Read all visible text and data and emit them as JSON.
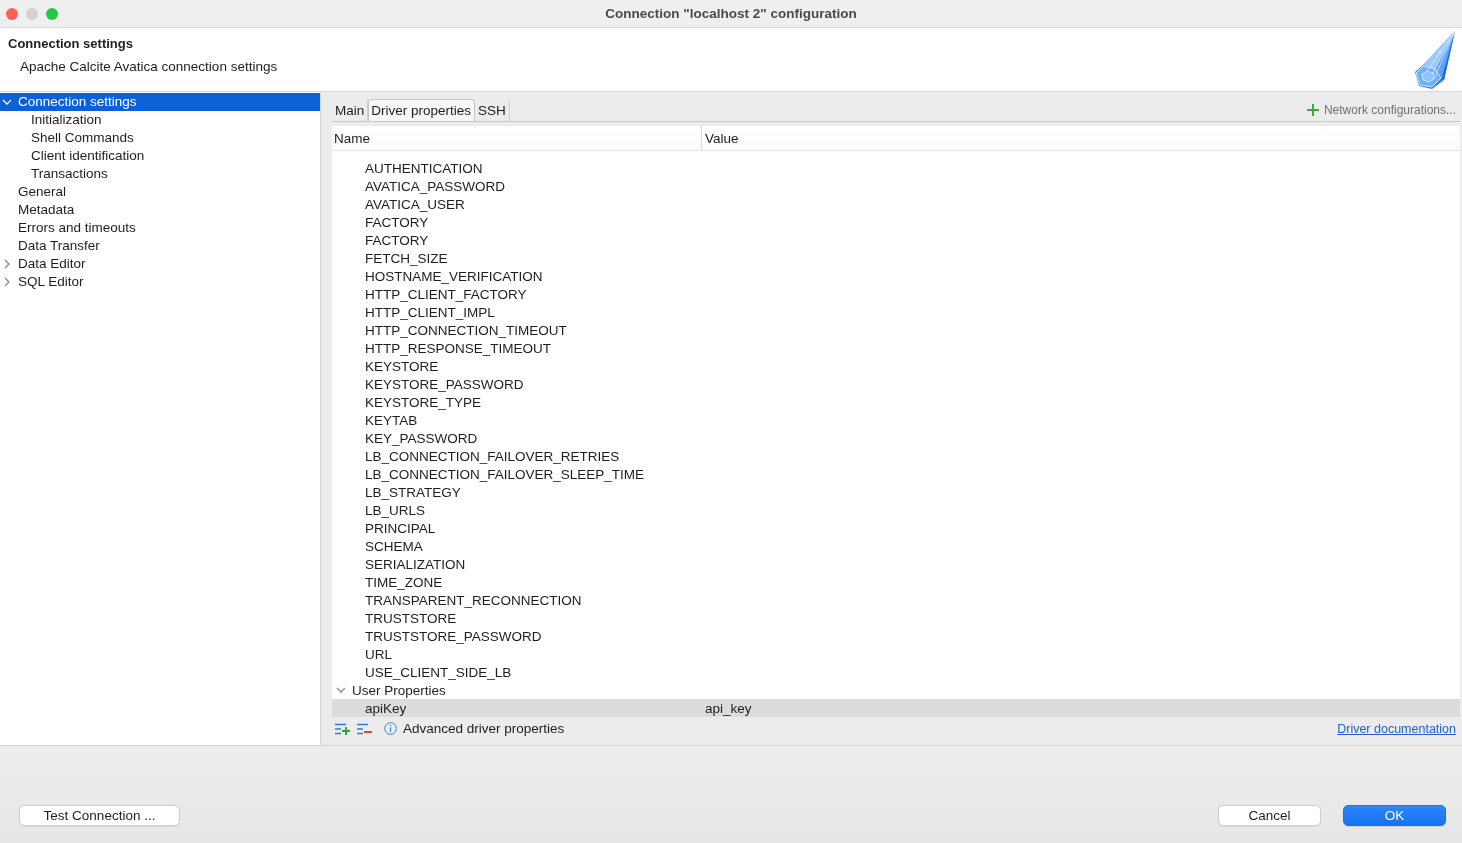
{
  "window": {
    "title": "Connection \"localhost 2\" configuration"
  },
  "header": {
    "title": "Connection settings",
    "subtitle": "Apache Calcite Avatica connection settings"
  },
  "sidebar": {
    "items": [
      {
        "label": "Connection settings",
        "selected": true,
        "expanded": true,
        "children": [
          {
            "label": "Initialization",
            "selected": false
          },
          {
            "label": "Shell Commands",
            "selected": false
          },
          {
            "label": "Client identification",
            "selected": false
          },
          {
            "label": "Transactions",
            "selected": false
          }
        ]
      },
      {
        "label": "General",
        "selected": false
      },
      {
        "label": "Metadata",
        "selected": false
      },
      {
        "label": "Errors and timeouts",
        "selected": false
      },
      {
        "label": "Data Transfer",
        "selected": false
      },
      {
        "label": "Data Editor",
        "selected": false,
        "expanded": false
      },
      {
        "label": "SQL Editor",
        "selected": false,
        "expanded": false
      }
    ]
  },
  "tabs": [
    {
      "label": "Main",
      "selected": false
    },
    {
      "label": "Driver properties",
      "selected": true
    },
    {
      "label": "SSH",
      "selected": false
    }
  ],
  "network_configurations": {
    "label": "Network configurations..."
  },
  "properties": {
    "columns": [
      "Name",
      "Value"
    ],
    "groups": [
      {
        "rows": [
          {
            "name": "AUTHENTICATION",
            "selected": false
          },
          {
            "name": "AVATICA_PASSWORD",
            "selected": false
          },
          {
            "name": "AVATICA_USER",
            "selected": false
          },
          {
            "name": "FACTORY",
            "selected": false
          },
          {
            "name": "FACTORY",
            "selected": false
          },
          {
            "name": "FETCH_SIZE",
            "selected": false
          },
          {
            "name": "HOSTNAME_VERIFICATION",
            "selected": false
          },
          {
            "name": "HTTP_CLIENT_FACTORY",
            "selected": false
          },
          {
            "name": "HTTP_CLIENT_IMPL",
            "selected": false
          },
          {
            "name": "HTTP_CONNECTION_TIMEOUT",
            "selected": false
          },
          {
            "name": "HTTP_RESPONSE_TIMEOUT",
            "selected": false
          },
          {
            "name": "KEYSTORE",
            "selected": false
          },
          {
            "name": "KEYSTORE_PASSWORD",
            "selected": false
          },
          {
            "name": "KEYSTORE_TYPE",
            "selected": false
          },
          {
            "name": "KEYTAB",
            "selected": false
          },
          {
            "name": "KEY_PASSWORD",
            "selected": false
          },
          {
            "name": "LB_CONNECTION_FAILOVER_RETRIES",
            "selected": false
          },
          {
            "name": "LB_CONNECTION_FAILOVER_SLEEP_TIME",
            "selected": false
          },
          {
            "name": "LB_STRATEGY",
            "selected": false
          },
          {
            "name": "LB_URLS",
            "selected": false
          },
          {
            "name": "PRINCIPAL",
            "selected": false
          },
          {
            "name": "SCHEMA",
            "selected": false
          },
          {
            "name": "SERIALIZATION",
            "selected": false
          },
          {
            "name": "TIME_ZONE",
            "selected": false
          },
          {
            "name": "TRANSPARENT_RECONNECTION",
            "selected": false
          },
          {
            "name": "TRUSTSTORE",
            "selected": false
          },
          {
            "name": "TRUSTSTORE_PASSWORD",
            "selected": false
          },
          {
            "name": "URL",
            "selected": false
          },
          {
            "name": "USE_CLIENT_SIDE_LB",
            "selected": false
          }
        ]
      },
      {
        "label": "User Properties",
        "expanded": true,
        "rows": [
          {
            "name": "apiKey",
            "value": "api_key",
            "selected": true
          }
        ]
      }
    ]
  },
  "toolbar": {
    "info": "Advanced driver properties",
    "link": "Driver documentation"
  },
  "footer": {
    "test_button": {
      "label": "Test Connection ..."
    },
    "buttons": [
      {
        "label": "Cancel",
        "primary": false
      },
      {
        "label": "OK",
        "primary": true
      }
    ]
  }
}
